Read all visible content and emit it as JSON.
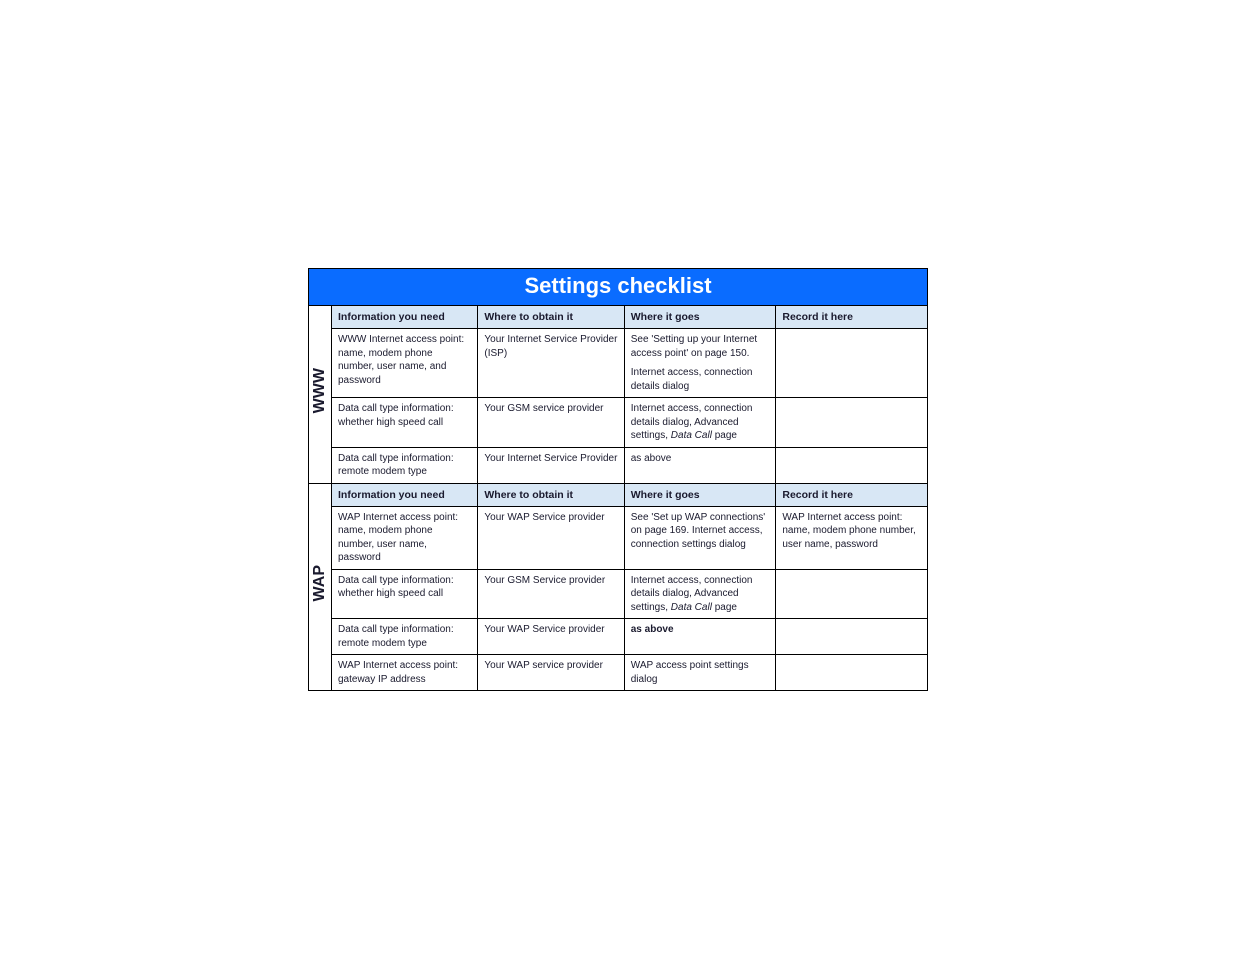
{
  "title": "Settings checklist",
  "headers": {
    "info": "Information you need",
    "obtain": "Where to obtain it",
    "goes": "Where it goes",
    "record": "Record it here"
  },
  "sections": [
    {
      "label": "WWW",
      "rows": [
        {
          "info": "WWW Internet access point: name, modem phone number, user name, and password",
          "obtain": "Your Internet Service Provider (ISP)",
          "goes_p1": "See 'Setting up your Internet access point' on page 150.",
          "goes_p2": "Internet access, connection details dialog",
          "record": ""
        },
        {
          "info": "Data call type information: whether high speed call",
          "obtain": "Your GSM service provider",
          "goes_pre": "Internet access, connection details dialog, Advanced settings, ",
          "goes_ital": "Data Call",
          "goes_post": " page",
          "record": ""
        },
        {
          "info": "Data call type information: remote modem type",
          "obtain": "Your Internet Service Provider",
          "goes": "as above",
          "record": ""
        }
      ]
    },
    {
      "label": "WAP",
      "rows": [
        {
          "info": "WAP Internet access point: name, modem phone number, user name, password",
          "obtain": "Your WAP Service provider",
          "goes": "See 'Set up WAP connections' on page 169. Internet access, connection settings dialog",
          "record": "WAP Internet access point: name, modem phone number, user name, password"
        },
        {
          "info": "Data call type information: whether high speed call",
          "obtain": "Your GSM Service provider",
          "goes_pre": "Internet access, connection details dialog, Advanced settings, ",
          "goes_ital": "Data Call",
          "goes_post": " page",
          "record": ""
        },
        {
          "info": "Data call type information: remote modem type",
          "obtain": "Your WAP Service provider",
          "goes_bold": "as above",
          "record": ""
        },
        {
          "info": "WAP Internet access point: gateway IP address",
          "obtain": "Your WAP service provider",
          "goes": "WAP access point settings dialog",
          "record": ""
        }
      ]
    }
  ]
}
